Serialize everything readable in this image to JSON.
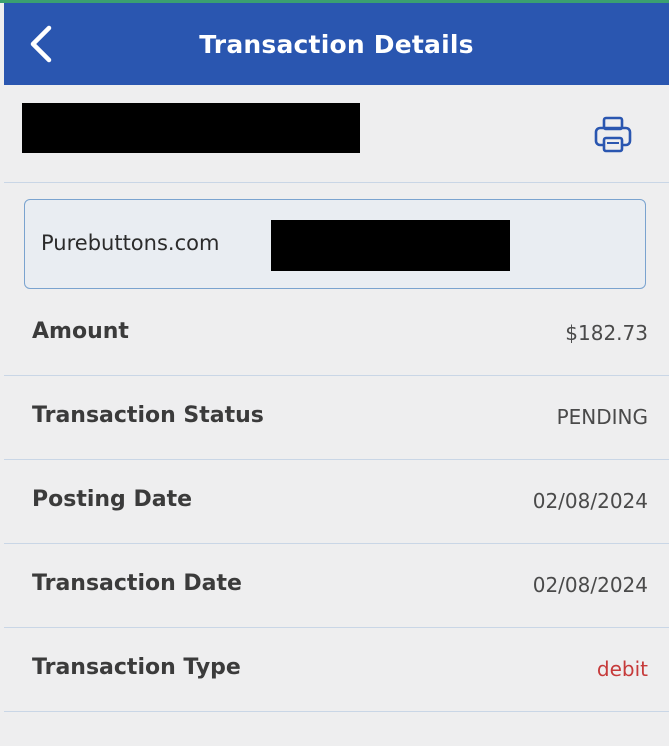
{
  "header": {
    "title": "Transaction Details",
    "back_icon": "chevron-left-icon",
    "background": "#2a56b0"
  },
  "account": {
    "print_icon": "printer-icon"
  },
  "merchant": {
    "name": "Purebuttons.com"
  },
  "details": [
    {
      "label": "Amount",
      "value": "$182.73"
    },
    {
      "label": "Transaction Status",
      "value": "PENDING"
    },
    {
      "label": "Posting Date",
      "value": "02/08/2024"
    },
    {
      "label": "Transaction Date",
      "value": "02/08/2024"
    },
    {
      "label": "Transaction Type",
      "value": "debit",
      "value_color": "#c63a3a"
    }
  ]
}
